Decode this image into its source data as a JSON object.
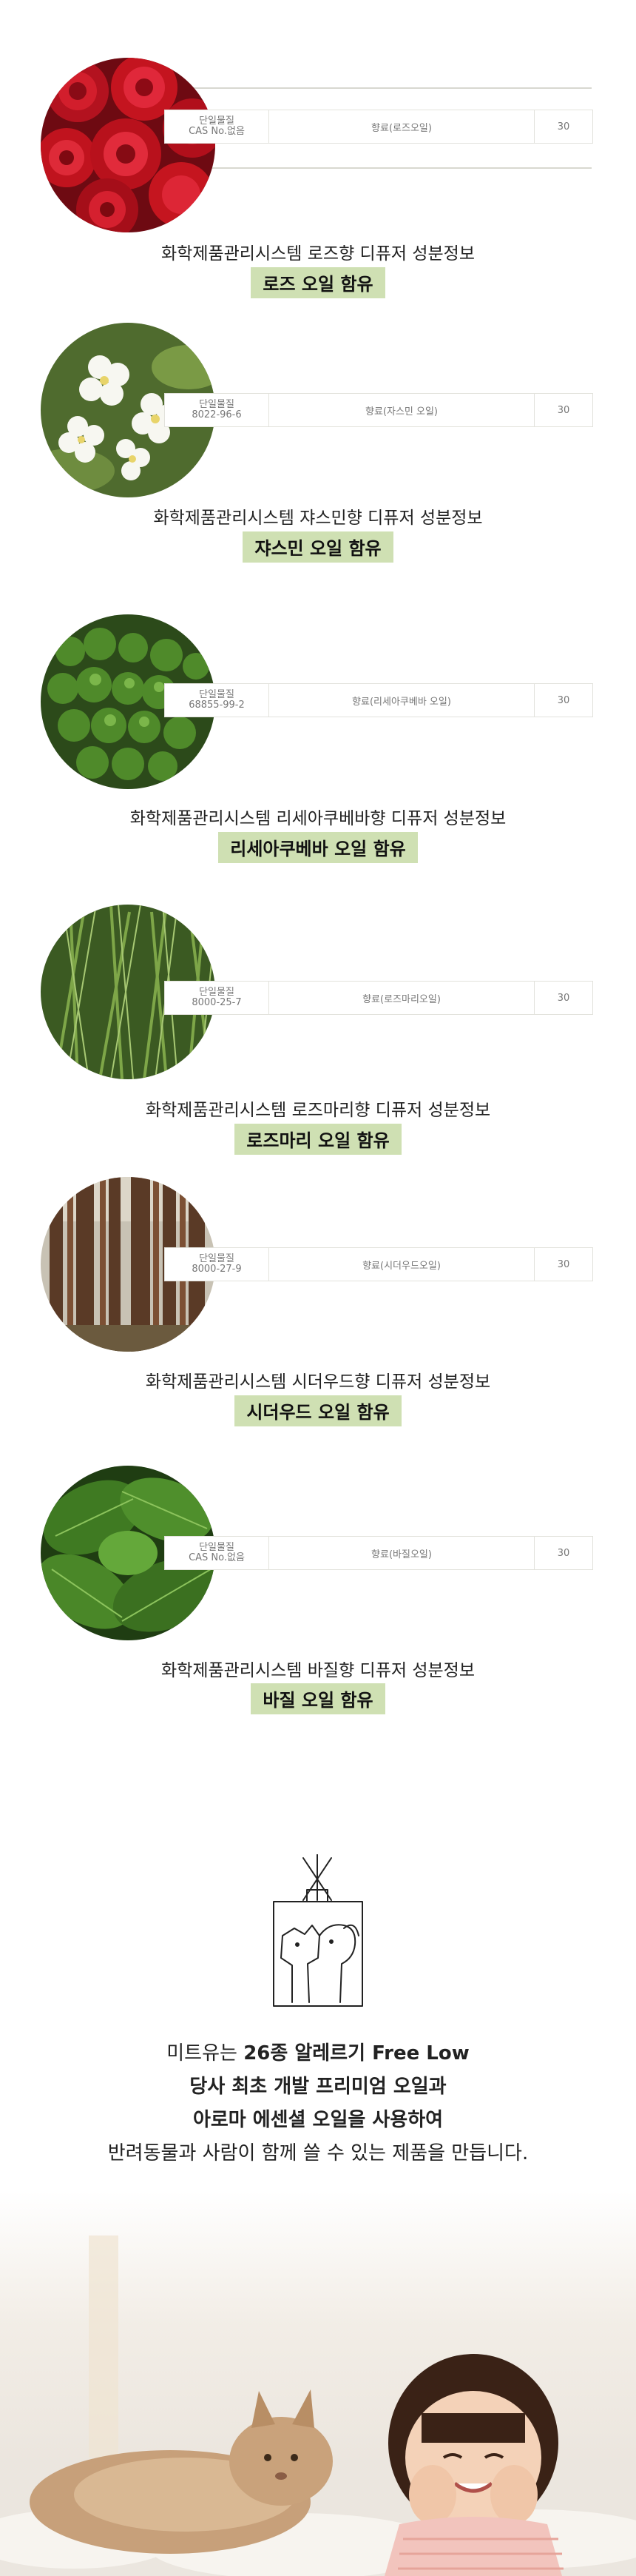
{
  "sections": [
    {
      "image": "rose-petals-image",
      "cas_label": "단일물질",
      "cas_value": "CAS No.없음",
      "name": "향료(로즈오일)",
      "amount": "30",
      "caption": "화학제품관리시스템 로즈향 디퓨저 성분정보",
      "highlight": "로즈 오일 함유"
    },
    {
      "image": "jasmine-flowers-image",
      "cas_label": "단일물질",
      "cas_value": "8022-96-6",
      "name": "향료(자스민 오일)",
      "amount": "30",
      "caption": "화학제품관리시스템 쟈스민향 디퓨저 성분정보",
      "highlight": "쟈스민 오일 함유"
    },
    {
      "image": "litsea-cubeba-berries-image",
      "cas_label": "단일물질",
      "cas_value": "68855-99-2",
      "name": "향료(리세아쿠베바 오일)",
      "amount": "30",
      "caption": "화학제품관리시스템 리세아쿠베바향 디퓨저 성분정보",
      "highlight": "리세아쿠베바 오일 함유"
    },
    {
      "image": "rosemary-leaves-image",
      "cas_label": "단일물질",
      "cas_value": "8000-25-7",
      "name": "향료(로즈마리오일)",
      "amount": "30",
      "caption": "화학제품관리시스템 로즈마리향 디퓨저 성분정보",
      "highlight": "로즈마리 오일 함유"
    },
    {
      "image": "cedarwood-forest-image",
      "cas_label": "단일물질",
      "cas_value": "8000-27-9",
      "name": "향료(시더우드오일)",
      "amount": "30",
      "caption": "화학제품관리시스템 시더우드향 디퓨저 성분정보",
      "highlight": "시더우드 오일 함유"
    },
    {
      "image": "basil-leaves-image",
      "cas_label": "단일물질",
      "cas_value": "CAS No.없음",
      "name": "향료(바질오일)",
      "amount": "30",
      "caption": "화학제품관리시스템 바질향 디퓨저 성분정보",
      "highlight": "바질 오일 함유"
    }
  ],
  "intro": {
    "line1_pre": "미트유는 ",
    "line1_bold": "26종 알레르기 Free Low",
    "line2": "당사 최초 개발 프리미엄 오일과",
    "line3": "아로마 에센셜 오일을 사용하여",
    "line4": "반려동물과 사람이 함께 쓸 수 있는 제품을 만듭니다."
  },
  "colors": {
    "highlight": "#cfe0b3",
    "table_border": "#e2e2dc"
  }
}
